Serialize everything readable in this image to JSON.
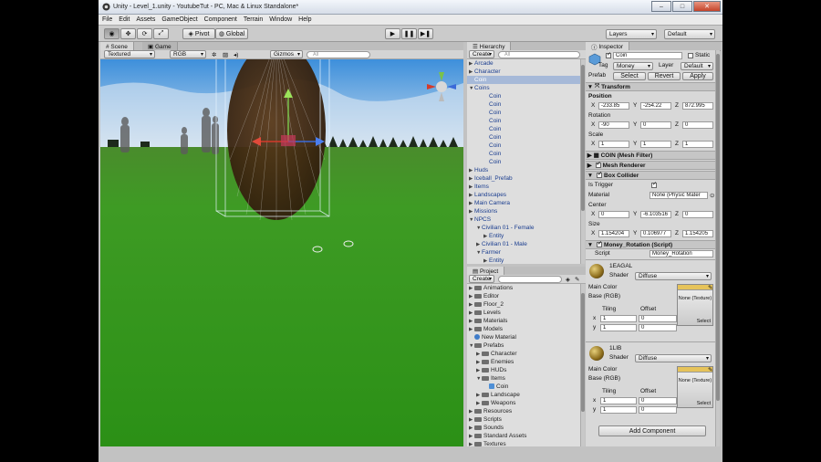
{
  "window": {
    "title": "Unity - Level_1.unity - YoutubeTut - PC, Mac & Linux Standalone*"
  },
  "menu": [
    "File",
    "Edit",
    "Assets",
    "GameObject",
    "Component",
    "Terrain",
    "Window",
    "Help"
  ],
  "toolbar": {
    "pivot": "Pivot",
    "global": "Global",
    "layers": "Layers",
    "layout": "Default"
  },
  "scene": {
    "tab_scene": "Scene",
    "tab_game": "Game",
    "render_mode": "Textured",
    "color_mode": "RGB",
    "gizmos": "Gizmos",
    "search": "All"
  },
  "hierarchy": {
    "title": "Hierarchy",
    "create": "Create",
    "search": "All",
    "rows": [
      {
        "label": "Arcade",
        "indent": 0,
        "arrow": "▶"
      },
      {
        "label": "Character",
        "indent": 0,
        "arrow": "▶"
      },
      {
        "label": "Coin",
        "indent": 0,
        "arrow": "",
        "selected": true
      },
      {
        "label": "Coins",
        "indent": 0,
        "arrow": "▼"
      },
      {
        "label": "Coin",
        "indent": 2,
        "arrow": ""
      },
      {
        "label": "Coin",
        "indent": 2,
        "arrow": ""
      },
      {
        "label": "Coin",
        "indent": 2,
        "arrow": ""
      },
      {
        "label": "Coin",
        "indent": 2,
        "arrow": ""
      },
      {
        "label": "Coin",
        "indent": 2,
        "arrow": ""
      },
      {
        "label": "Coin",
        "indent": 2,
        "arrow": ""
      },
      {
        "label": "Coin",
        "indent": 2,
        "arrow": ""
      },
      {
        "label": "Coin",
        "indent": 2,
        "arrow": ""
      },
      {
        "label": "Coin",
        "indent": 2,
        "arrow": ""
      },
      {
        "label": "Huds",
        "indent": 0,
        "arrow": "▶"
      },
      {
        "label": "Iceball_Prefab",
        "indent": 0,
        "arrow": "▶"
      },
      {
        "label": "Items",
        "indent": 0,
        "arrow": "▶"
      },
      {
        "label": "Landscapes",
        "indent": 0,
        "arrow": "▶"
      },
      {
        "label": "Main Camera",
        "indent": 0,
        "arrow": "▶"
      },
      {
        "label": "Missions",
        "indent": 0,
        "arrow": "▶"
      },
      {
        "label": "NPCS",
        "indent": 0,
        "arrow": "▼"
      },
      {
        "label": "Civilian 01 - Female",
        "indent": 1,
        "arrow": "▼"
      },
      {
        "label": "Entity",
        "indent": 2,
        "arrow": "▶"
      },
      {
        "label": "Civilian 01 - Male",
        "indent": 1,
        "arrow": "▶"
      },
      {
        "label": "Farmer",
        "indent": 1,
        "arrow": "▼"
      },
      {
        "label": "Entity",
        "indent": 2,
        "arrow": "▶"
      }
    ]
  },
  "project": {
    "title": "Project",
    "create": "Create",
    "rows": [
      {
        "label": "Animations",
        "indent": 0,
        "arrow": "▶",
        "icon": "folder"
      },
      {
        "label": "Editor",
        "indent": 0,
        "arrow": "▶",
        "icon": "folder"
      },
      {
        "label": "Floor_2",
        "indent": 0,
        "arrow": "▶",
        "icon": "folder"
      },
      {
        "label": "Levels",
        "indent": 0,
        "arrow": "▶",
        "icon": "folder"
      },
      {
        "label": "Materials",
        "indent": 0,
        "arrow": "▶",
        "icon": "folder"
      },
      {
        "label": "Models",
        "indent": 0,
        "arrow": "▶",
        "icon": "folder"
      },
      {
        "label": "New Material",
        "indent": 0,
        "arrow": "",
        "icon": "material"
      },
      {
        "label": "Prefabs",
        "indent": 0,
        "arrow": "▼",
        "icon": "folder"
      },
      {
        "label": "Character",
        "indent": 1,
        "arrow": "▶",
        "icon": "folder"
      },
      {
        "label": "Enemies",
        "indent": 1,
        "arrow": "▶",
        "icon": "folder"
      },
      {
        "label": "HUDs",
        "indent": 1,
        "arrow": "▶",
        "icon": "folder"
      },
      {
        "label": "Items",
        "indent": 1,
        "arrow": "▼",
        "icon": "folder"
      },
      {
        "label": "Coin",
        "indent": 2,
        "arrow": "",
        "icon": "prefab"
      },
      {
        "label": "Landscape",
        "indent": 1,
        "arrow": "▶",
        "icon": "folder"
      },
      {
        "label": "Weapons",
        "indent": 1,
        "arrow": "▶",
        "icon": "folder"
      },
      {
        "label": "Resources",
        "indent": 0,
        "arrow": "▶",
        "icon": "folder"
      },
      {
        "label": "Scripts",
        "indent": 0,
        "arrow": "▶",
        "icon": "folder"
      },
      {
        "label": "Sounds",
        "indent": 0,
        "arrow": "▶",
        "icon": "folder"
      },
      {
        "label": "Standard Assets",
        "indent": 0,
        "arrow": "▶",
        "icon": "folder"
      },
      {
        "label": "Textures",
        "indent": 0,
        "arrow": "▶",
        "icon": "folder"
      }
    ]
  },
  "inspector": {
    "title": "Inspector",
    "object_name": "Coin",
    "static": "Static",
    "tag_label": "Tag",
    "tag": "Money",
    "layer_label": "Layer",
    "layer": "Default",
    "prefab": "Prefab",
    "select": "Select",
    "revert": "Revert",
    "apply": "Apply",
    "transform": "Transform",
    "position": "Position",
    "px": "-233.85",
    "py": "-254.22",
    "pz": "872.995",
    "rotation": "Rotation",
    "rx": "-90",
    "ry": "0",
    "rz": "0",
    "scale": "Scale",
    "sx": "1",
    "sy": "1",
    "sz": "1",
    "mesh_filter": "COIN (Mesh Filter)",
    "mesh_renderer": "Mesh Renderer",
    "box_collider": "Box Collider",
    "is_trigger": "Is Trigger",
    "material_label": "Material",
    "material_value": "None (Physic Mater",
    "center": "Center",
    "cx": "0",
    "cy": "-6.103516",
    "cz": "0",
    "size": "Size",
    "szx": "1.154204",
    "szy": "0.106977",
    "szz": "1.154205",
    "money_rotation": "Money_Rotation (Script)",
    "script_label": "Script",
    "script_value": "Money_Rotation",
    "mat1": {
      "name": "1EAGAL",
      "shader_label": "Shader",
      "shader": "Diffuse"
    },
    "mat2": {
      "name": "1LIB",
      "shader_label": "Shader",
      "shader": "Diffuse"
    },
    "main_color": "Main Color",
    "base_rgb": "Base (RGB)",
    "tiling": "Tiling",
    "offset": "Offset",
    "x": "x",
    "y": "y",
    "tiling_x": "1",
    "tiling_y": "1",
    "offset_x": "0",
    "offset_y": "0",
    "none_texture": "None (Texture)",
    "select_btn": "Select",
    "add_component": "Add Component"
  }
}
